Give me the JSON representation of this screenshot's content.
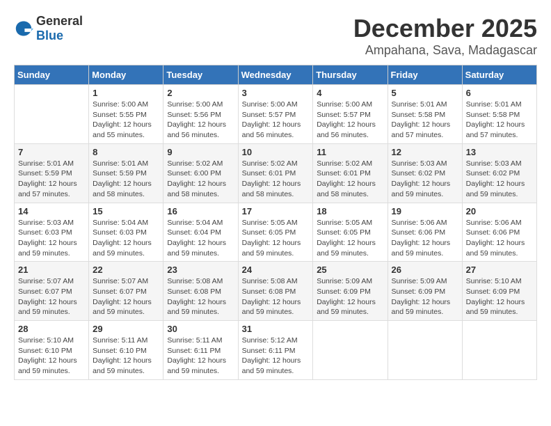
{
  "header": {
    "logo_general": "General",
    "logo_blue": "Blue",
    "month": "December 2025",
    "location": "Ampahana, Sava, Madagascar"
  },
  "days_of_week": [
    "Sunday",
    "Monday",
    "Tuesday",
    "Wednesday",
    "Thursday",
    "Friday",
    "Saturday"
  ],
  "weeks": [
    [
      {
        "day": "",
        "info": ""
      },
      {
        "day": "1",
        "info": "Sunrise: 5:00 AM\nSunset: 5:55 PM\nDaylight: 12 hours\nand 55 minutes."
      },
      {
        "day": "2",
        "info": "Sunrise: 5:00 AM\nSunset: 5:56 PM\nDaylight: 12 hours\nand 56 minutes."
      },
      {
        "day": "3",
        "info": "Sunrise: 5:00 AM\nSunset: 5:57 PM\nDaylight: 12 hours\nand 56 minutes."
      },
      {
        "day": "4",
        "info": "Sunrise: 5:00 AM\nSunset: 5:57 PM\nDaylight: 12 hours\nand 56 minutes."
      },
      {
        "day": "5",
        "info": "Sunrise: 5:01 AM\nSunset: 5:58 PM\nDaylight: 12 hours\nand 57 minutes."
      },
      {
        "day": "6",
        "info": "Sunrise: 5:01 AM\nSunset: 5:58 PM\nDaylight: 12 hours\nand 57 minutes."
      }
    ],
    [
      {
        "day": "7",
        "info": "Sunrise: 5:01 AM\nSunset: 5:59 PM\nDaylight: 12 hours\nand 57 minutes."
      },
      {
        "day": "8",
        "info": "Sunrise: 5:01 AM\nSunset: 5:59 PM\nDaylight: 12 hours\nand 58 minutes."
      },
      {
        "day": "9",
        "info": "Sunrise: 5:02 AM\nSunset: 6:00 PM\nDaylight: 12 hours\nand 58 minutes."
      },
      {
        "day": "10",
        "info": "Sunrise: 5:02 AM\nSunset: 6:01 PM\nDaylight: 12 hours\nand 58 minutes."
      },
      {
        "day": "11",
        "info": "Sunrise: 5:02 AM\nSunset: 6:01 PM\nDaylight: 12 hours\nand 58 minutes."
      },
      {
        "day": "12",
        "info": "Sunrise: 5:03 AM\nSunset: 6:02 PM\nDaylight: 12 hours\nand 59 minutes."
      },
      {
        "day": "13",
        "info": "Sunrise: 5:03 AM\nSunset: 6:02 PM\nDaylight: 12 hours\nand 59 minutes."
      }
    ],
    [
      {
        "day": "14",
        "info": "Sunrise: 5:03 AM\nSunset: 6:03 PM\nDaylight: 12 hours\nand 59 minutes."
      },
      {
        "day": "15",
        "info": "Sunrise: 5:04 AM\nSunset: 6:03 PM\nDaylight: 12 hours\nand 59 minutes."
      },
      {
        "day": "16",
        "info": "Sunrise: 5:04 AM\nSunset: 6:04 PM\nDaylight: 12 hours\nand 59 minutes."
      },
      {
        "day": "17",
        "info": "Sunrise: 5:05 AM\nSunset: 6:05 PM\nDaylight: 12 hours\nand 59 minutes."
      },
      {
        "day": "18",
        "info": "Sunrise: 5:05 AM\nSunset: 6:05 PM\nDaylight: 12 hours\nand 59 minutes."
      },
      {
        "day": "19",
        "info": "Sunrise: 5:06 AM\nSunset: 6:06 PM\nDaylight: 12 hours\nand 59 minutes."
      },
      {
        "day": "20",
        "info": "Sunrise: 5:06 AM\nSunset: 6:06 PM\nDaylight: 12 hours\nand 59 minutes."
      }
    ],
    [
      {
        "day": "21",
        "info": "Sunrise: 5:07 AM\nSunset: 6:07 PM\nDaylight: 12 hours\nand 59 minutes."
      },
      {
        "day": "22",
        "info": "Sunrise: 5:07 AM\nSunset: 6:07 PM\nDaylight: 12 hours\nand 59 minutes."
      },
      {
        "day": "23",
        "info": "Sunrise: 5:08 AM\nSunset: 6:08 PM\nDaylight: 12 hours\nand 59 minutes."
      },
      {
        "day": "24",
        "info": "Sunrise: 5:08 AM\nSunset: 6:08 PM\nDaylight: 12 hours\nand 59 minutes."
      },
      {
        "day": "25",
        "info": "Sunrise: 5:09 AM\nSunset: 6:09 PM\nDaylight: 12 hours\nand 59 minutes."
      },
      {
        "day": "26",
        "info": "Sunrise: 5:09 AM\nSunset: 6:09 PM\nDaylight: 12 hours\nand 59 minutes."
      },
      {
        "day": "27",
        "info": "Sunrise: 5:10 AM\nSunset: 6:09 PM\nDaylight: 12 hours\nand 59 minutes."
      }
    ],
    [
      {
        "day": "28",
        "info": "Sunrise: 5:10 AM\nSunset: 6:10 PM\nDaylight: 12 hours\nand 59 minutes."
      },
      {
        "day": "29",
        "info": "Sunrise: 5:11 AM\nSunset: 6:10 PM\nDaylight: 12 hours\nand 59 minutes."
      },
      {
        "day": "30",
        "info": "Sunrise: 5:11 AM\nSunset: 6:11 PM\nDaylight: 12 hours\nand 59 minutes."
      },
      {
        "day": "31",
        "info": "Sunrise: 5:12 AM\nSunset: 6:11 PM\nDaylight: 12 hours\nand 59 minutes."
      },
      {
        "day": "",
        "info": ""
      },
      {
        "day": "",
        "info": ""
      },
      {
        "day": "",
        "info": ""
      }
    ]
  ]
}
